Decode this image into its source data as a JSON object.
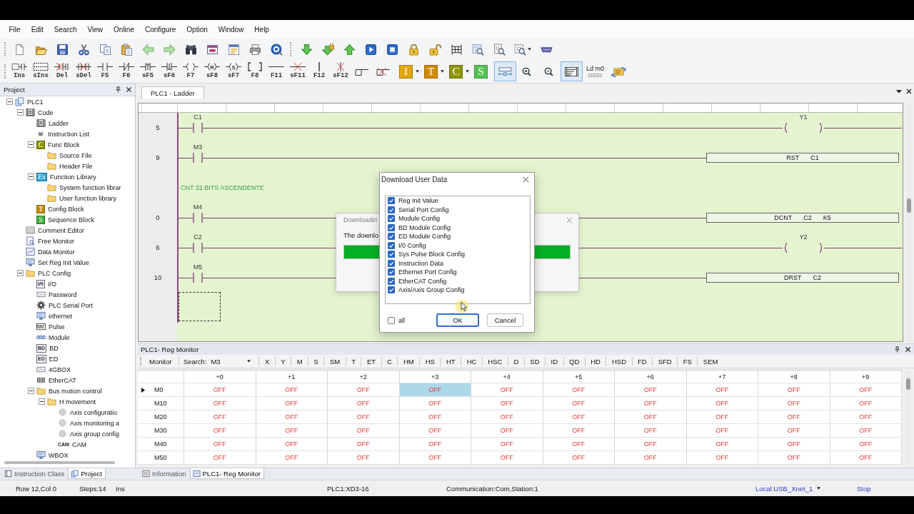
{
  "menu": [
    "File",
    "Edit",
    "Search",
    "View",
    "Online",
    "Configure",
    "Option",
    "Window",
    "Help"
  ],
  "ladder_toolbar": [
    {
      "label": "Ins",
      "kind": "insert"
    },
    {
      "label": "sIns",
      "kind": "insert-row"
    },
    {
      "label": "Del",
      "kind": "delete"
    },
    {
      "label": "sDel",
      "kind": "delete-row"
    },
    {
      "label": "F5",
      "kind": "open-contact"
    },
    {
      "label": "F6",
      "kind": "closed-contact"
    },
    {
      "label": "sF5",
      "kind": "rising-contact"
    },
    {
      "label": "sF6",
      "kind": "falling-contact"
    },
    {
      "label": "F7",
      "kind": "coil"
    },
    {
      "label": "sF8",
      "kind": "coil",
      "glyph": "R"
    },
    {
      "label": "sF7",
      "kind": "coil",
      "glyph": "S"
    },
    {
      "label": "F8",
      "kind": "instruction"
    },
    {
      "label": "F11",
      "kind": "hline"
    },
    {
      "label": "sF11",
      "kind": "hline-delete"
    },
    {
      "label": "F12",
      "kind": "vline"
    },
    {
      "label": "sF12",
      "kind": "vline-delete"
    }
  ],
  "block_tiles": [
    {
      "text": "I",
      "color": "#e2a70e",
      "dropdown": true
    },
    {
      "text": "T",
      "color": "#d08c08",
      "dropdown": true
    },
    {
      "text": "C",
      "color": "#8c9600",
      "dropdown": true
    },
    {
      "text": "S",
      "color": "#55c255",
      "dropdown": false
    }
  ],
  "view_tools": [
    {
      "kind": "fit-width",
      "selected": true
    },
    {
      "kind": "zoom-in",
      "selected": false
    },
    {
      "kind": "zoom-out",
      "selected": false
    },
    {
      "kind": "ladder-view",
      "selected": true
    },
    {
      "kind": "text-view",
      "label": "Ld m0",
      "selected": false
    },
    {
      "kind": "convert",
      "selected": false
    }
  ],
  "project": {
    "title": "Project",
    "tree": [
      {
        "label": "PLC1",
        "kind": "plc",
        "expanded": true,
        "children": [
          {
            "label": "Code",
            "kind": "ladder",
            "expanded": true,
            "children": [
              {
                "label": "Ladder",
                "kind": "ladder"
              },
              {
                "label": "Instruction List",
                "kind": "label",
                "badge": "Id"
              },
              {
                "label": "Func Block",
                "kind": "tile",
                "badge": "C",
                "color": "#8c9600",
                "expanded": true,
                "children": [
                  {
                    "label": "Source File",
                    "kind": "folder"
                  },
                  {
                    "label": "Header File",
                    "kind": "folder"
                  }
                ]
              },
              {
                "label": "Function Library",
                "kind": "tile",
                "badge": "Ex",
                "color": "#2ea3d6",
                "expanded": true,
                "children": [
                  {
                    "label": "System function librar",
                    "kind": "folder"
                  },
                  {
                    "label": "User function library",
                    "kind": "folder"
                  }
                ]
              },
              {
                "label": "Config Block",
                "kind": "tile",
                "badge": "T",
                "color": "#c98c00"
              },
              {
                "label": "Sequence Block",
                "kind": "tile",
                "badge": "S",
                "color": "#3fae3f"
              }
            ]
          },
          {
            "label": "Comment Editor",
            "kind": "grid"
          },
          {
            "label": "Free Monitor",
            "kind": "monitor"
          },
          {
            "label": "Data Monitor",
            "kind": "chart"
          },
          {
            "label": "Set Reg Init Value",
            "kind": "screen"
          },
          {
            "label": "PLC Config",
            "kind": "folder",
            "expanded": true,
            "children": [
              {
                "label": "I/O",
                "kind": "boxed",
                "badge": "I/0"
              },
              {
                "label": "Password",
                "kind": "device"
              },
              {
                "label": "PLC Serial Port",
                "kind": "gear"
              },
              {
                "label": "ethernet",
                "kind": "screen"
              },
              {
                "label": "Pulse",
                "kind": "wave"
              },
              {
                "label": "Module",
                "kind": "module"
              },
              {
                "label": "BD",
                "kind": "boxed",
                "badge": "BD"
              },
              {
                "label": "ED",
                "kind": "boxed",
                "badge": "ED"
              },
              {
                "label": "4GBOX",
                "kind": "device"
              },
              {
                "label": "EtherCAT",
                "kind": "bars"
              },
              {
                "label": "Bus motion control",
                "kind": "folder",
                "expanded": true,
                "children": [
                  {
                    "label": "H movement",
                    "kind": "folder",
                    "expanded": true,
                    "children": [
                      {
                        "label": "Axis configuratio",
                        "kind": "axis"
                      },
                      {
                        "label": "Axis monitoring a",
                        "kind": "axis"
                      },
                      {
                        "label": "Axis group config",
                        "kind": "axis"
                      },
                      {
                        "label": "CAM",
                        "kind": "label",
                        "badge": "CAM"
                      }
                    ]
                  }
                ]
              },
              {
                "label": "WBOX",
                "kind": "screen"
              }
            ]
          }
        ]
      }
    ],
    "tabs": [
      {
        "label": "Instruction Class",
        "kind": "book",
        "selected": false
      },
      {
        "label": "Project",
        "kind": "project",
        "selected": true
      }
    ]
  },
  "editor": {
    "tabs": [
      {
        "label": "PLC1 - Ladder",
        "selected": true
      }
    ],
    "rungs": [
      {
        "kind": "rung",
        "step": "5",
        "contact": "C1",
        "output": {
          "kind": "coil",
          "label": "Y1"
        },
        "selected": false
      },
      {
        "kind": "rung",
        "step": "9",
        "contact": "M3",
        "output": {
          "kind": "instruction",
          "parts": [
            "RST",
            "C1"
          ]
        },
        "selected": false
      },
      {
        "kind": "comment",
        "text": "CNT 32 BITS ASCENDENTE",
        "selected": false
      },
      {
        "kind": "rung",
        "step": "0",
        "contact": "M4",
        "output": {
          "kind": "instruction",
          "parts": [
            "DCNT",
            "C2",
            "K5"
          ]
        },
        "selected": false
      },
      {
        "kind": "rung",
        "step": "6",
        "contact": "C2",
        "output": {
          "kind": "coil",
          "label": "Y2"
        },
        "selected": false
      },
      {
        "kind": "rung",
        "step": "10",
        "contact": "M5",
        "output": {
          "kind": "instruction",
          "parts": [
            "DRST",
            "C2"
          ]
        },
        "selected": false
      },
      {
        "kind": "empty",
        "selected": true
      }
    ]
  },
  "download_dialog": {
    "title": "Downloadin",
    "message": "The downlo",
    "level": 1
  },
  "user_data_dialog": {
    "title": "Download User Data",
    "options": [
      {
        "label": "Reg Init Value",
        "checked": true
      },
      {
        "label": "Serial Port Config",
        "checked": true
      },
      {
        "label": "Module Config",
        "checked": true
      },
      {
        "label": "BD Module Config",
        "checked": true
      },
      {
        "label": "ED Module Config",
        "checked": true
      },
      {
        "label": "I/0 Config",
        "checked": true
      },
      {
        "label": "Sys Pulse Block Config",
        "checked": true
      },
      {
        "label": "Instruction Data",
        "checked": true
      },
      {
        "label": "Ethernet Port Config",
        "checked": true
      },
      {
        "label": "EtherCAT Config",
        "checked": true
      },
      {
        "label": "Axis/Axis Group Config",
        "checked": true
      }
    ],
    "all": {
      "label": "all",
      "checked": false
    },
    "buttons": [
      {
        "label": "OK",
        "focused": true
      },
      {
        "label": "Cancel",
        "focused": false
      }
    ]
  },
  "reg_monitor": {
    "title": "PLC1- Reg Monitor",
    "monitor_button": "Monitor",
    "search_label": "Search:",
    "search_value": "M3",
    "register_types": [
      "X",
      "Y",
      "M",
      "S",
      "SM",
      "T",
      "ET",
      "C",
      "HM",
      "HS",
      "HT",
      "HC",
      "HSC",
      "D",
      "SD",
      "ID",
      "QD",
      "HD",
      "HSD",
      "FD",
      "SFD",
      "FS",
      "SEM"
    ],
    "columns": [
      "+0",
      "+1",
      "+2",
      "+3",
      "+4",
      "+5",
      "+6",
      "+7",
      "+8",
      "+9"
    ],
    "rows": [
      {
        "label": "M0",
        "current": true,
        "cells": [
          {
            "value": "OFF",
            "selected": false
          },
          {
            "value": "OFF",
            "selected": false
          },
          {
            "value": "OFF",
            "selected": false
          },
          {
            "value": "OFF",
            "selected": true
          },
          {
            "value": "OFF",
            "selected": false
          },
          {
            "value": "OFF",
            "selected": false
          },
          {
            "value": "OFF",
            "selected": false
          },
          {
            "value": "OFF",
            "selected": false
          },
          {
            "value": "OFF",
            "selected": false
          },
          {
            "value": "OFF",
            "selected": false
          }
        ]
      },
      {
        "label": "M10",
        "current": false,
        "cells": [
          {
            "value": "OFF",
            "selected": false
          },
          {
            "value": "OFF",
            "selected": false
          },
          {
            "value": "OFF",
            "selected": false
          },
          {
            "value": "OFF",
            "selected": false
          },
          {
            "value": "OFF",
            "selected": false
          },
          {
            "value": "OFF",
            "selected": false
          },
          {
            "value": "OFF",
            "selected": false
          },
          {
            "value": "OFF",
            "selected": false
          },
          {
            "value": "OFF",
            "selected": false
          },
          {
            "value": "OFF",
            "selected": false
          }
        ]
      },
      {
        "label": "M20",
        "current": false,
        "cells": [
          {
            "value": "OFF",
            "selected": false
          },
          {
            "value": "OFF",
            "selected": false
          },
          {
            "value": "OFF",
            "selected": false
          },
          {
            "value": "OFF",
            "selected": false
          },
          {
            "value": "OFF",
            "selected": false
          },
          {
            "value": "OFF",
            "selected": false
          },
          {
            "value": "OFF",
            "selected": false
          },
          {
            "value": "OFF",
            "selected": false
          },
          {
            "value": "OFF",
            "selected": false
          },
          {
            "value": "OFF",
            "selected": false
          }
        ]
      },
      {
        "label": "M30",
        "current": false,
        "cells": [
          {
            "value": "OFF",
            "selected": false
          },
          {
            "value": "OFF",
            "selected": false
          },
          {
            "value": "OFF",
            "selected": false
          },
          {
            "value": "OFF",
            "selected": false
          },
          {
            "value": "OFF",
            "selected": false
          },
          {
            "value": "OFF",
            "selected": false
          },
          {
            "value": "OFF",
            "selected": false
          },
          {
            "value": "OFF",
            "selected": false
          },
          {
            "value": "OFF",
            "selected": false
          },
          {
            "value": "OFF",
            "selected": false
          }
        ]
      },
      {
        "label": "M40",
        "current": false,
        "cells": [
          {
            "value": "OFF",
            "selected": false
          },
          {
            "value": "OFF",
            "selected": false
          },
          {
            "value": "OFF",
            "selected": false
          },
          {
            "value": "OFF",
            "selected": false
          },
          {
            "value": "OFF",
            "selected": false
          },
          {
            "value": "OFF",
            "selected": false
          },
          {
            "value": "OFF",
            "selected": false
          },
          {
            "value": "OFF",
            "selected": false
          },
          {
            "value": "OFF",
            "selected": false
          },
          {
            "value": "OFF",
            "selected": false
          }
        ]
      },
      {
        "label": "M50",
        "current": false,
        "cells": [
          {
            "value": "OFF",
            "selected": false
          },
          {
            "value": "OFF",
            "selected": false
          },
          {
            "value": "OFF",
            "selected": false
          },
          {
            "value": "OFF",
            "selected": false
          },
          {
            "value": "OFF",
            "selected": false
          },
          {
            "value": "OFF",
            "selected": false
          },
          {
            "value": "OFF",
            "selected": false
          },
          {
            "value": "OFF",
            "selected": false
          },
          {
            "value": "OFF",
            "selected": false
          },
          {
            "value": "OFF",
            "selected": false
          }
        ]
      }
    ]
  },
  "panel_tabs": [
    {
      "label": "Information",
      "kind": "info",
      "selected": false
    },
    {
      "label": "PLC1- Reg Monitor",
      "kind": "monitor",
      "selected": true
    }
  ],
  "status_bar": {
    "position": "Row 12,Col 0",
    "steps": "Steps:14",
    "mode": "Ins",
    "model": "PLC1:XD3-16",
    "communication": "Communication:Com,Station:1",
    "connection": "Local:USB_Xnet_1",
    "plc_state": "Stop"
  }
}
